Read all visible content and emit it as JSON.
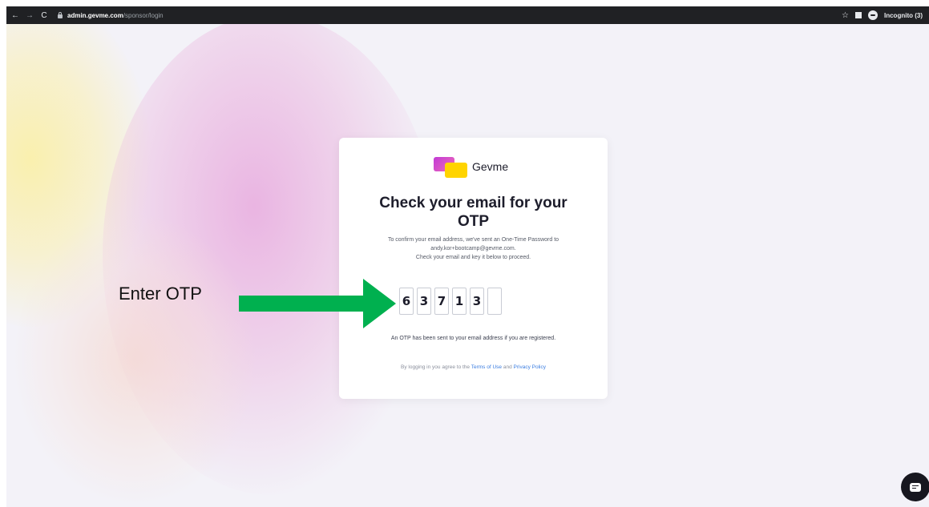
{
  "browser": {
    "url_host": "admin.gevme.com",
    "url_path": "/sponsor/login",
    "incognito_label": "Incognito (3)",
    "icons": [
      "back-icon",
      "forward-icon",
      "reload-icon",
      "lock-icon",
      "star-icon",
      "side-panel-icon",
      "incognito-icon"
    ]
  },
  "card": {
    "brand": "Gevme",
    "title_line1": "Check your email for your",
    "title_line2": "OTP",
    "desc_line1": "To confirm your email address, we've sent an One-Time Password to",
    "desc_line2": "andy.kor+bootcamp@gevme.com.",
    "desc_line3": "Check your email and key it below to proceed.",
    "otp_digits": [
      "6",
      "3",
      "7",
      "1",
      "3",
      ""
    ],
    "notice": "An OTP has been sent to your email address if you are registered.",
    "terms_prefix": "By logging in you agree to the",
    "terms_link": "Terms of Use",
    "terms_and": "and",
    "privacy_link": "Privacy Policy"
  },
  "annotation": {
    "label": "Enter OTP",
    "arrow_color": "#00b04f"
  },
  "colors": {
    "accent_link": "#3b7de0",
    "logo_magenta": "#c13ad6",
    "logo_yellow": "#ffd400"
  }
}
